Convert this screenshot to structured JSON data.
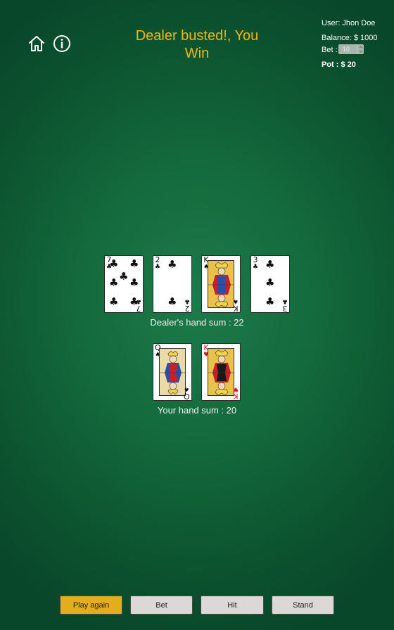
{
  "header": {
    "home_icon": "home-icon",
    "info_icon": "info-icon",
    "status_line1": "Dealer busted!, You",
    "status_line2": "Win",
    "status_color": "#f2b51c"
  },
  "account": {
    "user_label": "User: Jhon Doe",
    "balance_label": "Balance: $ 1000",
    "bet_label": "Bet :",
    "bet_value": "10",
    "pot_label": "Pot : $ 20"
  },
  "dealer": {
    "cards": [
      {
        "rank": "7",
        "suit": "♣",
        "color": "black"
      },
      {
        "rank": "2",
        "suit": "♣",
        "color": "black"
      },
      {
        "rank": "K",
        "suit": "♠",
        "color": "black"
      },
      {
        "rank": "3",
        "suit": "♣",
        "color": "black"
      }
    ],
    "sum_label": "Dealer's hand sum : 22"
  },
  "player": {
    "cards": [
      {
        "rank": "Q",
        "suit": "♠",
        "color": "black"
      },
      {
        "rank": "K",
        "suit": "♥",
        "color": "red"
      }
    ],
    "sum_label": "Your hand sum : 20"
  },
  "controls": {
    "play_again": "Play again",
    "bet": "Bet",
    "hit": "Hit",
    "stand": "Stand"
  }
}
